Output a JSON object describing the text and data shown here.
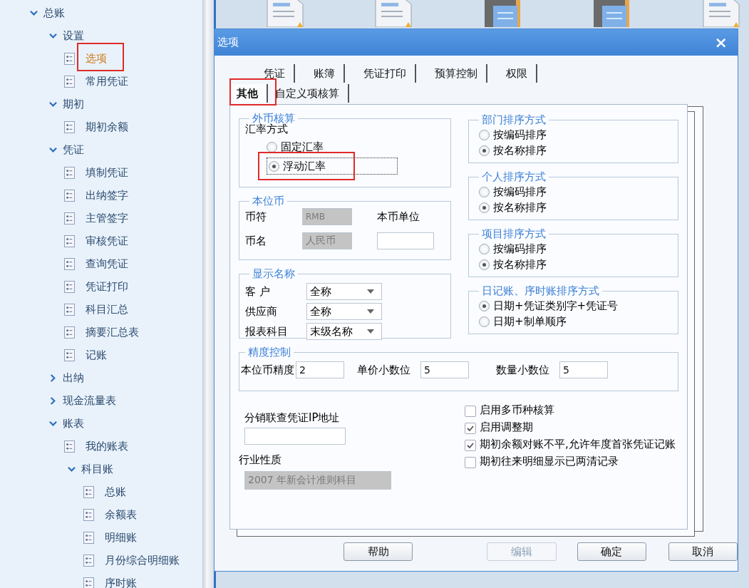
{
  "sidebar": {
    "items": [
      {
        "label": "总账",
        "kind": "branch",
        "expanded": true,
        "children": [
          {
            "label": "设置",
            "kind": "branch",
            "expanded": true,
            "children": [
              {
                "label": "选项",
                "kind": "leaf",
                "selected": true,
                "highlighted": true
              },
              {
                "label": "常用凭证",
                "kind": "leaf",
                "selected": false,
                "highlighted": false
              }
            ]
          },
          {
            "label": "期初",
            "kind": "branch",
            "expanded": true,
            "children": [
              {
                "label": "期初余额",
                "kind": "leaf",
                "selected": false,
                "highlighted": false
              }
            ]
          },
          {
            "label": "凭证",
            "kind": "branch",
            "expanded": true,
            "children": [
              {
                "label": "填制凭证",
                "kind": "leaf",
                "selected": false,
                "highlighted": false
              },
              {
                "label": "出纳签字",
                "kind": "leaf",
                "selected": false,
                "highlighted": false
              },
              {
                "label": "主管签字",
                "kind": "leaf",
                "selected": false,
                "highlighted": false
              },
              {
                "label": "审核凭证",
                "kind": "leaf",
                "selected": false,
                "highlighted": false
              },
              {
                "label": "查询凭证",
                "kind": "leaf",
                "selected": false,
                "highlighted": false
              },
              {
                "label": "凭证打印",
                "kind": "leaf",
                "selected": false,
                "highlighted": false
              },
              {
                "label": "科目汇总",
                "kind": "leaf",
                "selected": false,
                "highlighted": false
              },
              {
                "label": "摘要汇总表",
                "kind": "leaf",
                "selected": false,
                "highlighted": false
              },
              {
                "label": "记账",
                "kind": "leaf",
                "selected": false,
                "highlighted": false
              }
            ]
          },
          {
            "label": "出纳",
            "kind": "branch",
            "expanded": false
          },
          {
            "label": "现金流量表",
            "kind": "branch",
            "expanded": false
          },
          {
            "label": "账表",
            "kind": "branch",
            "expanded": true,
            "children": [
              {
                "label": "我的账表",
                "kind": "leaf",
                "selected": false,
                "highlighted": false
              },
              {
                "label": "科目账",
                "kind": "branch",
                "expanded": true,
                "children": [
                  {
                    "label": "总账",
                    "kind": "leaf",
                    "selected": false,
                    "highlighted": false
                  },
                  {
                    "label": "余额表",
                    "kind": "leaf",
                    "selected": false,
                    "highlighted": false
                  },
                  {
                    "label": "明细账",
                    "kind": "leaf",
                    "selected": false,
                    "highlighted": false
                  },
                  {
                    "label": "月份综合明细账",
                    "kind": "leaf",
                    "selected": false,
                    "highlighted": false
                  },
                  {
                    "label": "序时账",
                    "kind": "leaf",
                    "selected": false,
                    "highlighted": false
                  }
                ]
              }
            ]
          }
        ]
      }
    ]
  },
  "dialog": {
    "title": "选项",
    "close": "×",
    "tab_rows": [
      [
        {
          "label": "凭证",
          "selected": false,
          "highlighted": false
        },
        {
          "label": "账簿",
          "selected": false,
          "highlighted": false
        },
        {
          "label": "凭证打印",
          "selected": false,
          "highlighted": false
        },
        {
          "label": "预算控制",
          "selected": false,
          "highlighted": false
        },
        {
          "label": "权限",
          "selected": false,
          "highlighted": false
        }
      ],
      [
        {
          "label": "其他",
          "selected": true,
          "highlighted": true
        },
        {
          "label": "自定义项核算",
          "selected": false,
          "highlighted": false
        }
      ]
    ],
    "foreign_currency": {
      "title": "外币核算",
      "label": "汇率方式",
      "options": [
        {
          "label": "固定汇率",
          "selected": false,
          "focused": false,
          "highlighted": false
        },
        {
          "label": "浮动汇率",
          "selected": true,
          "focused": true,
          "highlighted": true
        }
      ]
    },
    "base_currency": {
      "title": "本位币",
      "symbol_label": "币符",
      "symbol": "RMB",
      "unit_label": "本币单位",
      "name_label": "币名",
      "name": "人民币"
    },
    "display_names": {
      "title": "显示名称",
      "rows": [
        {
          "label": "客 户",
          "value": "全称"
        },
        {
          "label": "供应商",
          "value": "全称"
        },
        {
          "label": "报表科目",
          "value": "末级名称"
        }
      ]
    },
    "sort_groups": [
      {
        "title": "部门排序方式",
        "options": [
          {
            "label": "按编码排序",
            "selected": false
          },
          {
            "label": "按名称排序",
            "selected": true
          }
        ]
      },
      {
        "title": "个人排序方式",
        "options": [
          {
            "label": "按编码排序",
            "selected": false
          },
          {
            "label": "按名称排序",
            "selected": true
          }
        ]
      },
      {
        "title": "项目排序方式",
        "options": [
          {
            "label": "按编码排序",
            "selected": false
          },
          {
            "label": "按名称排序",
            "selected": true
          }
        ]
      },
      {
        "title": "日记账、序时账排序方式",
        "options": [
          {
            "label": "日期+凭证类别字+凭证号",
            "selected": true
          },
          {
            "label": "日期+制单顺序",
            "selected": false
          }
        ]
      }
    ],
    "precision": {
      "title": "精度控制",
      "fields": [
        {
          "label": "本位币精度",
          "value": "2"
        },
        {
          "label": "单价小数位",
          "value": "5"
        },
        {
          "label": "数量小数位",
          "value": "5"
        }
      ]
    },
    "ip_label": "分销联查凭证IP地址",
    "industry_label": "行业性质",
    "industry": "2007 年新会计准则科目",
    "checkboxes": [
      {
        "label": "启用多币种核算",
        "checked": false
      },
      {
        "label": "启用调整期",
        "checked": true
      },
      {
        "label": "期初余额对账不平,允许年度首张凭证记账",
        "checked": true
      },
      {
        "label": "期初往来明细显示已两清记录",
        "checked": false
      }
    ],
    "buttons": [
      {
        "label": "帮助",
        "disabled": false
      },
      {
        "label": "编辑",
        "disabled": true
      },
      {
        "label": "确定",
        "disabled": false
      },
      {
        "label": "取消",
        "disabled": false
      }
    ]
  }
}
